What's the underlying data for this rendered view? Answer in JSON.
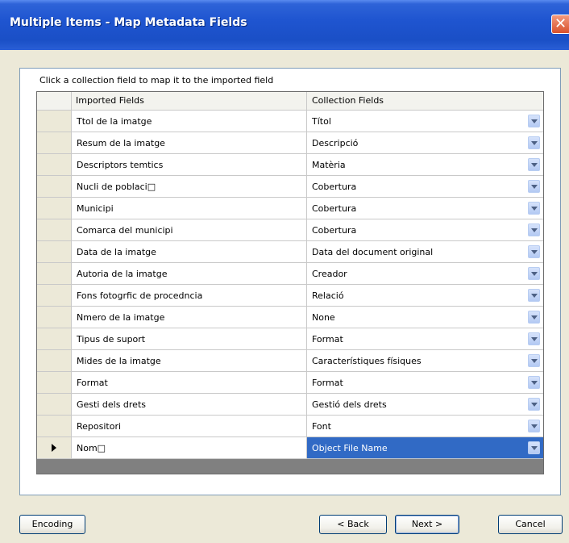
{
  "window": {
    "title": "Multiple Items - Map Metadata Fields"
  },
  "instruction": "Click a collection field to map it to the imported field",
  "grid": {
    "headers": {
      "imported": "Imported Fields",
      "collection": "Collection Fields"
    },
    "rows": [
      {
        "imported": "Ttol de la imatge",
        "collection": "Títol"
      },
      {
        "imported": "Resum de la imatge",
        "collection": "Descripció"
      },
      {
        "imported": "Descriptors temtics",
        "collection": "Matèria"
      },
      {
        "imported": "Nucli de poblaci□",
        "collection": "Cobertura"
      },
      {
        "imported": "Municipi",
        "collection": "Cobertura"
      },
      {
        "imported": "Comarca del municipi",
        "collection": "Cobertura"
      },
      {
        "imported": "Data de la imatge",
        "collection": "Data del document original"
      },
      {
        "imported": "Autoria de la imatge",
        "collection": "Creador"
      },
      {
        "imported": "Fons fotogrfic de procedncia",
        "collection": "Relació"
      },
      {
        "imported": "Nmero de la imatge",
        "collection": "None"
      },
      {
        "imported": "Tipus de suport",
        "collection": "Format"
      },
      {
        "imported": "Mides de la imatge",
        "collection": "Característiques físiques"
      },
      {
        "imported": "Format",
        "collection": "Format"
      },
      {
        "imported": "Gesti dels drets",
        "collection": "Gestió dels drets"
      },
      {
        "imported": "Repositori",
        "collection": "Font"
      },
      {
        "imported": "Nom□",
        "collection": "Object File Name"
      }
    ]
  },
  "buttons": {
    "encoding": "Encoding",
    "back": "< Back",
    "next": "Next >",
    "cancel": "Cancel"
  }
}
